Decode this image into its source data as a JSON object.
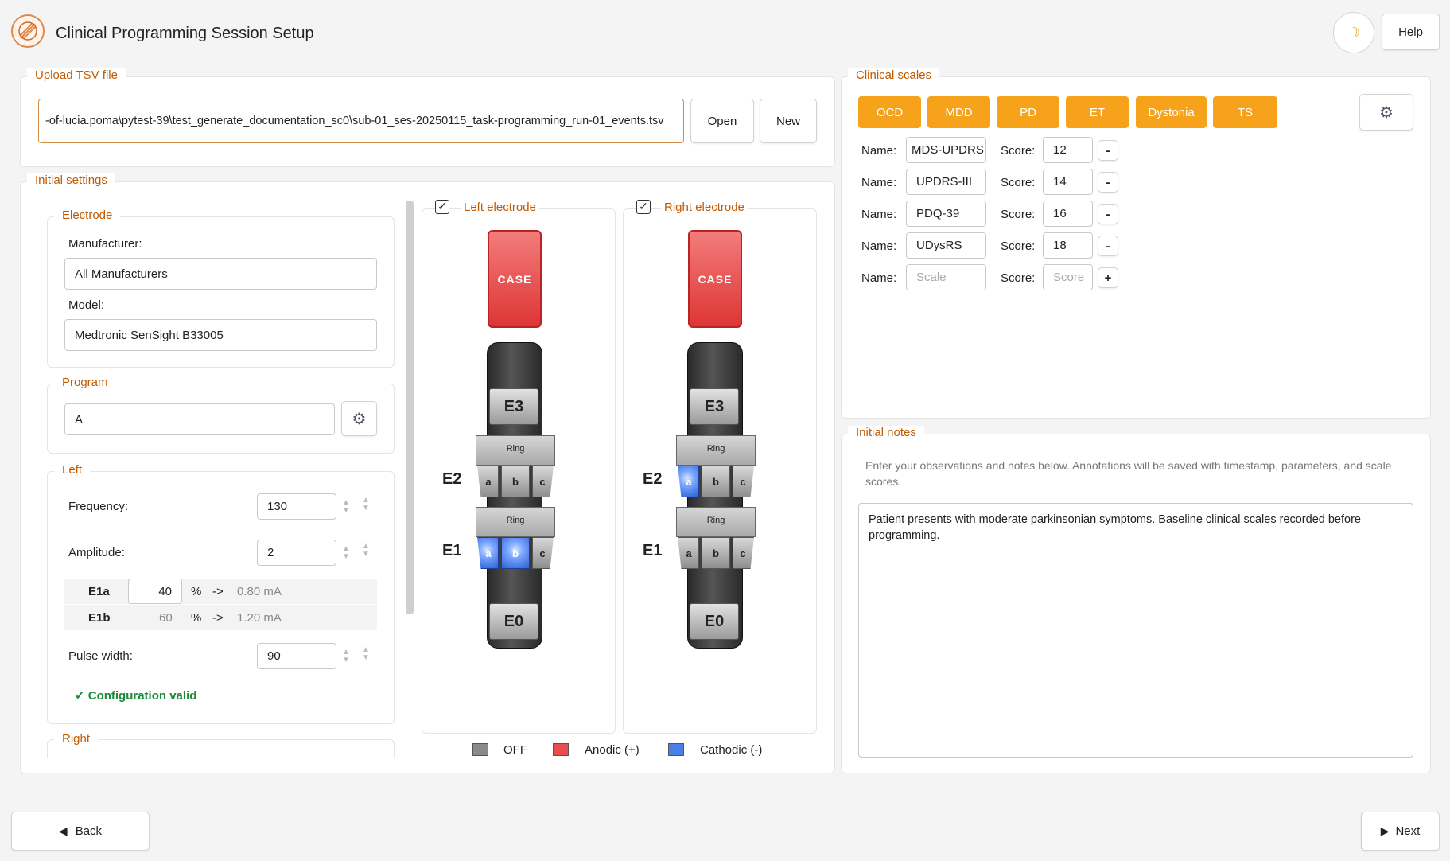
{
  "header": {
    "title": "Clinical Programming Session Setup",
    "help_label": "Help"
  },
  "upload": {
    "section_title": "Upload TSV file",
    "file_path": "-of-lucia.poma\\pytest-39\\test_generate_documentation_sc0\\sub-01_ses-20250115_task-programming_run-01_events.tsv",
    "open_label": "Open",
    "new_label": "New"
  },
  "initial_settings": {
    "section_title": "Initial settings",
    "electrode": {
      "title": "Electrode",
      "manufacturer_label": "Manufacturer:",
      "manufacturer_value": "All Manufacturers",
      "model_label": "Model:",
      "model_value": "Medtronic SenSight B33005"
    },
    "program": {
      "title": "Program",
      "value": "A"
    },
    "left": {
      "title": "Left",
      "frequency_label": "Frequency:",
      "frequency_value": "130",
      "amplitude_label": "Amplitude:",
      "amplitude_value": "2",
      "contacts": [
        {
          "name": "E1a",
          "percent": "40",
          "pct_sign": "%",
          "arrow": "->",
          "current": "0.80 mA"
        },
        {
          "name": "E1b",
          "percent": "60",
          "pct_sign": "%",
          "arrow": "->",
          "current": "1.20 mA"
        }
      ],
      "pulse_width_label": "Pulse width:",
      "pulse_width_value": "90",
      "status": "✓ Configuration valid"
    },
    "right": {
      "title": "Right"
    }
  },
  "electrodes": {
    "left": {
      "label": "Left electrode",
      "checked": true,
      "case": "CASE",
      "e3": "E3",
      "e2": "E2",
      "e1": "E1",
      "e0": "E0",
      "ring": "Ring",
      "a": "a",
      "b": "b",
      "c": "c"
    },
    "right": {
      "label": "Right electrode",
      "checked": true,
      "case": "CASE",
      "e3": "E3",
      "e2": "E2",
      "e1": "E1",
      "e0": "E0",
      "ring": "Ring",
      "a": "a",
      "b": "b",
      "c": "c"
    }
  },
  "legend": {
    "off": "OFF",
    "anodic": "Anodic (+)",
    "cathodic": "Cathodic (-)"
  },
  "clinical_scales": {
    "title": "Clinical scales",
    "buttons": [
      "OCD",
      "MDD",
      "PD",
      "ET",
      "Dystonia",
      "TS"
    ],
    "name_label": "Name:",
    "score_label": "Score:",
    "rows": [
      {
        "name": "MDS-UPDRS",
        "score": "12",
        "action": "-"
      },
      {
        "name": "UPDRS-III",
        "score": "14",
        "action": "-"
      },
      {
        "name": "PDQ-39",
        "score": "16",
        "action": "-"
      },
      {
        "name": "UDysRS",
        "score": "18",
        "action": "-"
      }
    ],
    "new_row": {
      "name_placeholder": "Scale",
      "score_placeholder": "Score",
      "action": "+"
    }
  },
  "notes": {
    "title": "Initial notes",
    "hint": "Enter your observations and notes below. Annotations will be saved with timestamp, parameters, and scale scores.",
    "text": "Patient presents with moderate parkinsonian symptoms. Baseline clinical scales recorded before programming."
  },
  "footer": {
    "back_label": "Back",
    "next_label": "Next"
  },
  "colors": {
    "accent": "#c25a00",
    "scale_button": "#f7a21b",
    "case_red": "#e84c4c",
    "cathodic_blue": "#4a7fe8",
    "valid_green": "#1a8a3a"
  }
}
